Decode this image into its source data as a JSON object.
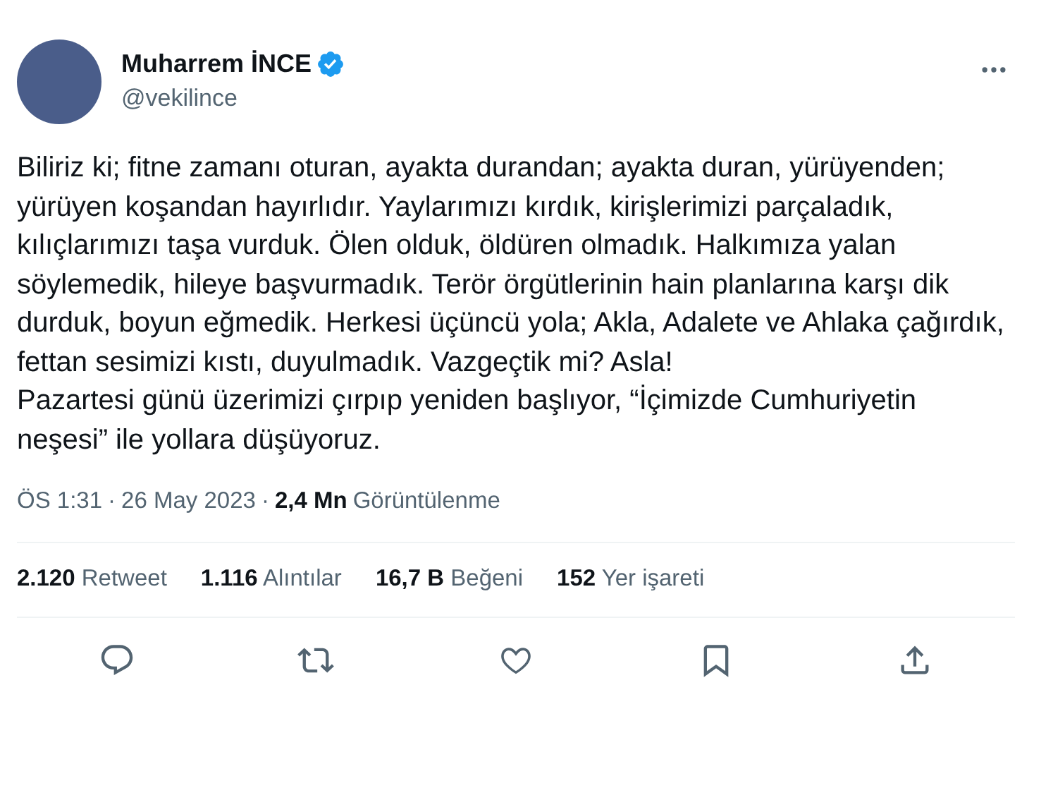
{
  "author": {
    "name": "Muharrem İNCE",
    "handle": "@vekilince",
    "verified": true
  },
  "body": [
    "Biliriz ki; fitne zamanı oturan, ayakta durandan; ayakta duran, yürüyenden; yürüyen koşandan hayırlıdır. Yaylarımızı kırdık, kirişlerimizi parçaladık, kılıçlarımızı taşa vurduk. Ölen olduk, öldüren olmadık. Halkımıza yalan söylemedik, hileye başvurmadık. Terör örgütlerinin hain planlarına karşı dik durduk, boyun eğmedik. Herkesi üçüncü yola; Akla, Adalete ve Ahlaka çağırdık, fettan sesimizi kıstı, duyulmadık. Vazgeçtik mi? Asla!",
    "Pazartesi günü üzerimizi çırpıp yeniden başlıyor, “İçimizde Cumhuriyetin neşesi” ile yollara düşüyoruz."
  ],
  "meta": {
    "time": "ÖS 1:31",
    "separator": "·",
    "date": "26 May 2023",
    "views": "2,4 Mn",
    "views_label": "Görüntülenme"
  },
  "stats": [
    {
      "count": "2.120",
      "label": "Retweet"
    },
    {
      "count": "1.116",
      "label": "Alıntılar"
    },
    {
      "count": "16,7 B",
      "label": "Beğeni"
    },
    {
      "count": "152",
      "label": "Yer işareti"
    }
  ],
  "actions": [
    {
      "kind": "reply"
    },
    {
      "kind": "retweet"
    },
    {
      "kind": "like"
    },
    {
      "kind": "bookmark"
    },
    {
      "kind": "share"
    }
  ]
}
